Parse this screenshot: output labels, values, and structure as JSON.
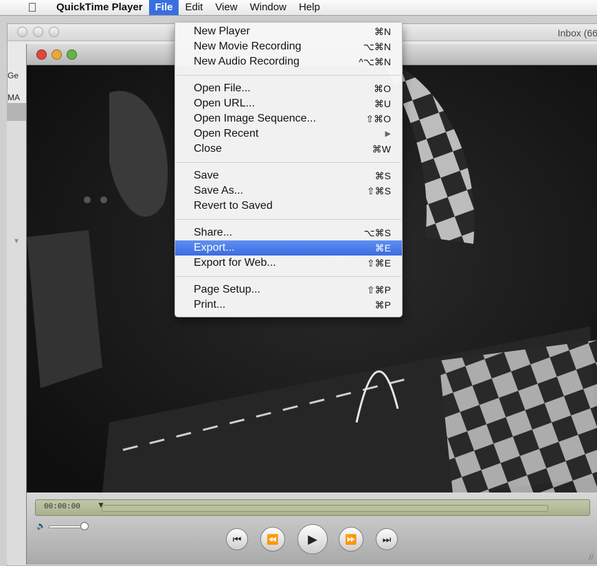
{
  "menubar": {
    "app_name": "QuickTime Player",
    "items": [
      "File",
      "Edit",
      "View",
      "Window",
      "Help"
    ]
  },
  "back_window": {
    "title_right": "Inbox (66",
    "left_labels": [
      "Ge",
      "MA"
    ]
  },
  "player": {
    "timecode": "00:00:00"
  },
  "file_menu": {
    "groups": [
      [
        {
          "label": "New Player",
          "shortcut": "⌘N"
        },
        {
          "label": "New Movie Recording",
          "shortcut": "⌥⌘N"
        },
        {
          "label": "New Audio Recording",
          "shortcut": "^⌥⌘N"
        }
      ],
      [
        {
          "label": "Open File...",
          "shortcut": "⌘O"
        },
        {
          "label": "Open URL...",
          "shortcut": "⌘U"
        },
        {
          "label": "Open Image Sequence...",
          "shortcut": "⇧⌘O"
        },
        {
          "label": "Open Recent",
          "shortcut": "▶"
        },
        {
          "label": "Close",
          "shortcut": "⌘W"
        }
      ],
      [
        {
          "label": "Save",
          "shortcut": "⌘S"
        },
        {
          "label": "Save As...",
          "shortcut": "⇧⌘S"
        },
        {
          "label": "Revert to Saved",
          "shortcut": ""
        }
      ],
      [
        {
          "label": "Share...",
          "shortcut": "⌥⌘S"
        },
        {
          "label": "Export...",
          "shortcut": "⌘E"
        },
        {
          "label": "Export for Web...",
          "shortcut": "⇧⌘E"
        }
      ],
      [
        {
          "label": "Page Setup...",
          "shortcut": "⇧⌘P"
        },
        {
          "label": "Print...",
          "shortcut": "⌘P"
        }
      ]
    ]
  },
  "colors": {
    "menu_highlight": "#3a6ee0",
    "close_light": "#e2463f",
    "minimize_light": "#e9a93a",
    "zoom_light": "#67b247"
  }
}
